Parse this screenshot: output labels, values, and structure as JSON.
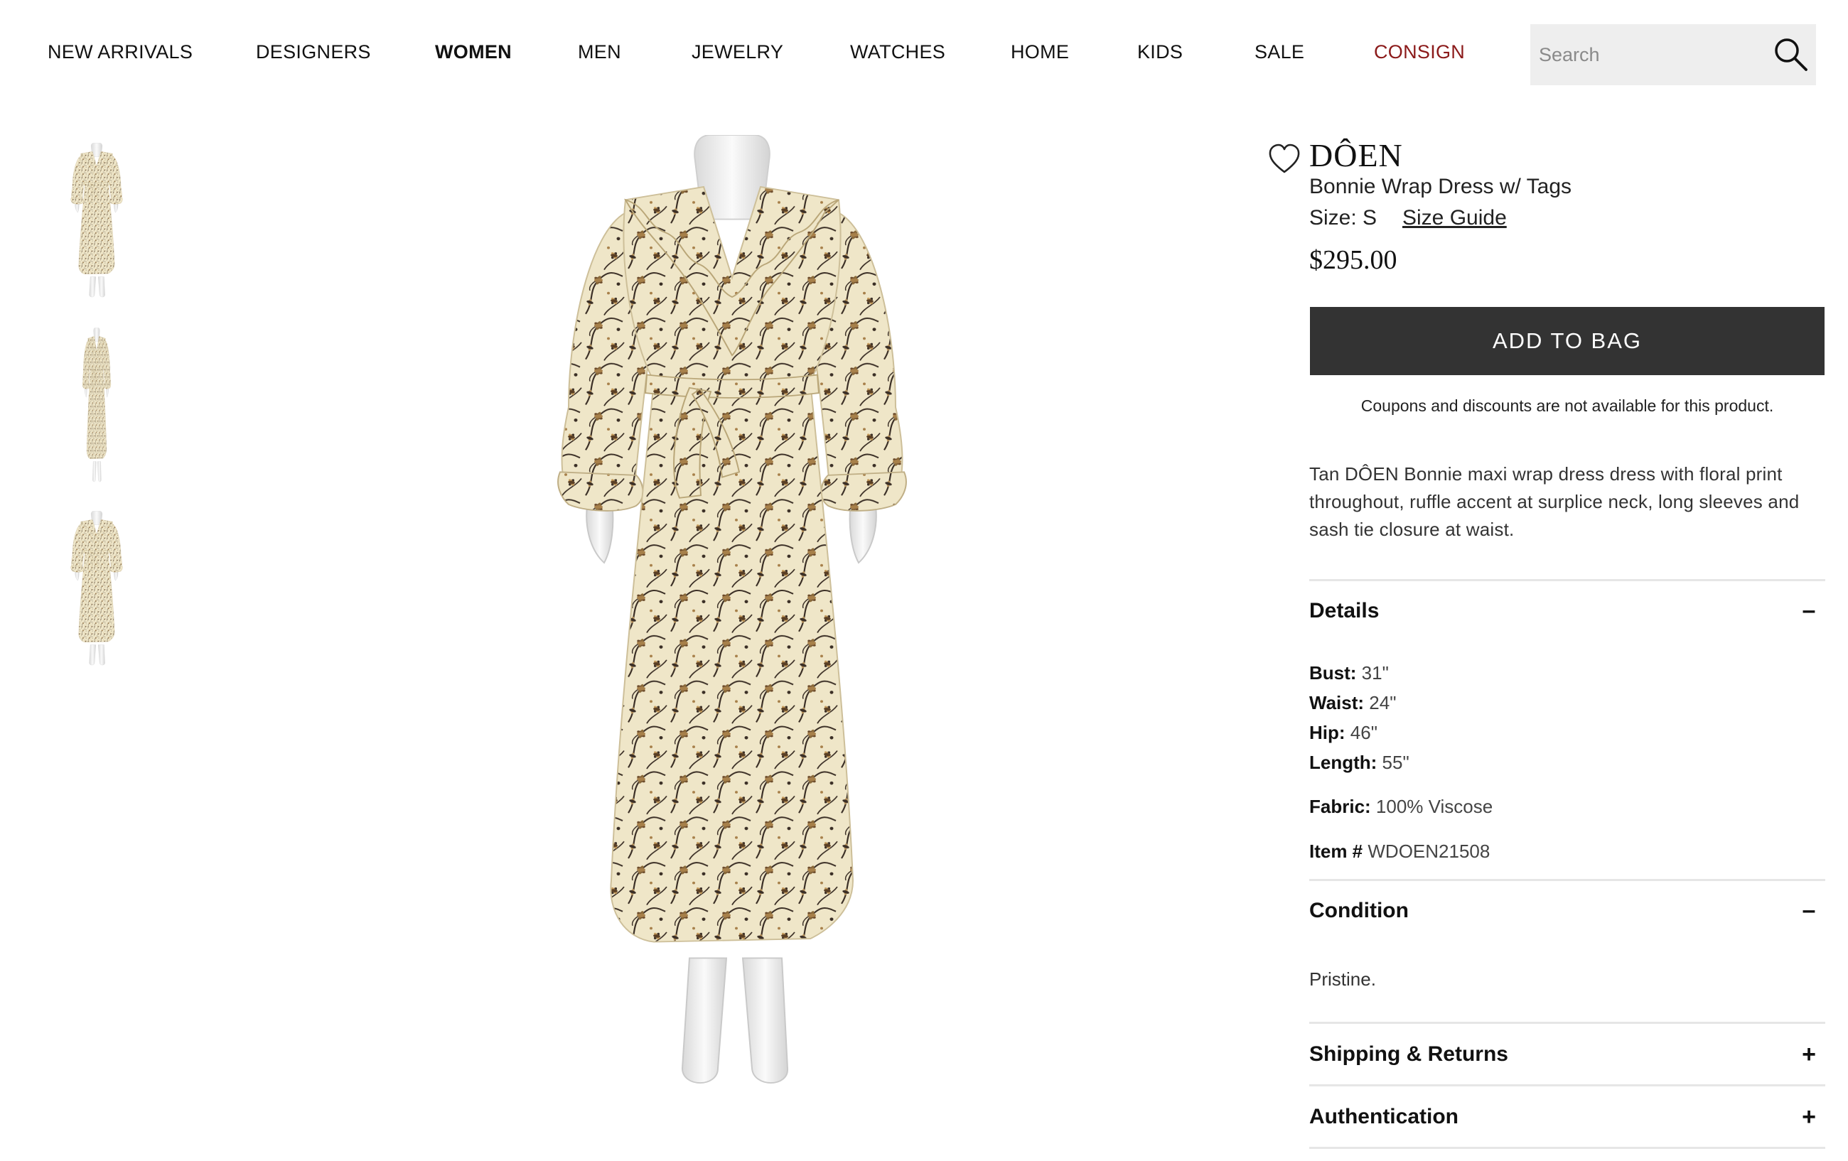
{
  "nav": {
    "items": [
      {
        "label": "NEW ARRIVALS"
      },
      {
        "label": "DESIGNERS"
      },
      {
        "label": "WOMEN"
      },
      {
        "label": "MEN"
      },
      {
        "label": "JEWELRY"
      },
      {
        "label": "WATCHES"
      },
      {
        "label": "HOME"
      },
      {
        "label": "KIDS"
      },
      {
        "label": "SALE"
      },
      {
        "label": "CONSIGN"
      }
    ],
    "active": "WOMEN",
    "accent_item": "CONSIGN",
    "accent_color": "#8b1a1a"
  },
  "search": {
    "placeholder": "Search",
    "value": "",
    "icon": "search-icon"
  },
  "gallery": {
    "thumbnails": [
      "front view",
      "side view",
      "back view"
    ],
    "dress_color": "#efe6c8",
    "print_color": "#3b2f26"
  },
  "product": {
    "brand": "DÔEN",
    "name": "Bonnie Wrap Dress w/ Tags",
    "size_label": "Size:",
    "size_value": "S",
    "size_guide": "Size Guide",
    "price": "$295.00",
    "add_to_bag": "ADD TO BAG",
    "coupon_note": "Coupons and discounts are not available for this product.",
    "description": "Tan DÔEN Bonnie maxi wrap dress dress with floral print throughout, ruffle accent at surplice neck, long sleeves and sash tie closure at waist.",
    "wishlist_icon": "heart-icon"
  },
  "details": {
    "title": "Details",
    "toggle": "–",
    "bust_label": "Bust:",
    "bust_value": "31\"",
    "waist_label": "Waist:",
    "waist_value": "24\"",
    "hip_label": "Hip:",
    "hip_value": "46\"",
    "length_label": "Length:",
    "length_value": "55\"",
    "fabric_label": "Fabric:",
    "fabric_value": "100% Viscose",
    "item_label": "Item #",
    "item_value": "WDOEN21508"
  },
  "condition": {
    "title": "Condition",
    "toggle": "–",
    "text": "Pristine."
  },
  "shipping": {
    "title": "Shipping & Returns",
    "toggle": "+"
  },
  "authentication": {
    "title": "Authentication",
    "toggle": "+"
  },
  "colors": {
    "button_bg": "#333333",
    "divider": "#e6e6e6",
    "search_bg": "#eeeeee"
  }
}
